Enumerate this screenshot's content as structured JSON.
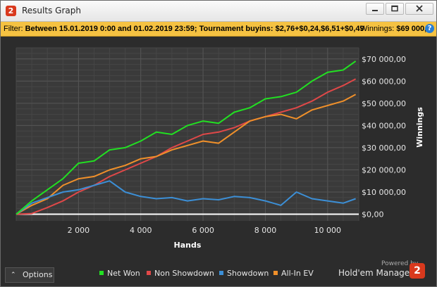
{
  "window": {
    "title": "Results Graph",
    "app_icon_glyph": "2",
    "controls": [
      "minimize-icon",
      "maximize-icon",
      "close-icon"
    ]
  },
  "filter_bar": {
    "prefix": "Filter: ",
    "text": "Between 15.01.2019 0:00 and 01.02.2019 23:59; Tournament buyins: $2,76+$0,24,$6,51+$0,49",
    "winnings_label": "Winnings: ",
    "winnings_value": "$69 000,",
    "help_glyph": "?",
    "bar_color": "#f5c242"
  },
  "footer": {
    "options_label": "Options",
    "powered_by": "Powered by",
    "brand_name": "Hold'em Manager",
    "brand_glyph": "2"
  },
  "colors": {
    "net_won": "#22e022",
    "non_showdown": "#e04848",
    "showdown": "#3c8fd6",
    "all_in_ev": "#f0902a",
    "zero_line": "#ffffff",
    "plot_bg": "#3a3a3a"
  },
  "chart_data": {
    "type": "line",
    "title": "",
    "xlabel": "Hands",
    "ylabel": "Winnings",
    "xlim": [
      0,
      11000
    ],
    "ylim": [
      -3000,
      75000
    ],
    "x_ticks": [
      2000,
      4000,
      6000,
      8000,
      10000
    ],
    "x_tick_labels": [
      "2 000",
      "4 000",
      "6 000",
      "8 000",
      "10 000"
    ],
    "y_ticks": [
      0,
      10000,
      20000,
      30000,
      40000,
      50000,
      60000,
      70000
    ],
    "y_tick_labels": [
      "$0,00",
      "$10 000,00",
      "$20 000,00",
      "$30 000,00",
      "$40 000,00",
      "$50 000,00",
      "$60 000,00",
      "$70 000,00"
    ],
    "grid": true,
    "legend_position": "bottom",
    "series": [
      {
        "name": "Net Won",
        "color": "#22e022",
        "x": [
          0,
          500,
          1000,
          1500,
          2000,
          2500,
          3000,
          3500,
          4000,
          4500,
          5000,
          5500,
          6000,
          6500,
          7000,
          7500,
          8000,
          8500,
          9000,
          9500,
          10000,
          10500,
          10900
        ],
        "values": [
          0,
          6000,
          11000,
          16000,
          23000,
          24000,
          29000,
          30000,
          33000,
          37000,
          36000,
          40000,
          42000,
          41000,
          46000,
          48000,
          52000,
          53000,
          55000,
          60000,
          64000,
          65000,
          69000
        ]
      },
      {
        "name": "Non Showdown",
        "color": "#e04848",
        "x": [
          0,
          500,
          1000,
          1500,
          2000,
          2500,
          3000,
          3500,
          4000,
          4500,
          5000,
          5500,
          6000,
          6500,
          7000,
          7500,
          8000,
          8500,
          9000,
          9500,
          10000,
          10500,
          10900
        ],
        "values": [
          0,
          300,
          3000,
          6000,
          10000,
          13000,
          17000,
          20000,
          23000,
          26000,
          30000,
          33000,
          36000,
          37000,
          39000,
          42000,
          44000,
          46000,
          48000,
          51000,
          55000,
          58000,
          61000
        ]
      },
      {
        "name": "Showdown",
        "color": "#3c8fd6",
        "x": [
          0,
          500,
          1000,
          1500,
          2000,
          2500,
          3000,
          3500,
          4000,
          4500,
          5000,
          5500,
          6000,
          6500,
          7000,
          7500,
          8000,
          8500,
          9000,
          9500,
          10000,
          10500,
          10900
        ],
        "values": [
          0,
          5000,
          7500,
          10000,
          11000,
          13000,
          15000,
          10000,
          8000,
          7000,
          7500,
          6000,
          7000,
          6500,
          8000,
          7500,
          6000,
          4000,
          10000,
          7000,
          6000,
          5000,
          7000
        ]
      },
      {
        "name": "All-In EV",
        "color": "#f0902a",
        "x": [
          0,
          500,
          1000,
          1500,
          2000,
          2500,
          3000,
          3500,
          4000,
          4500,
          5000,
          5500,
          6000,
          6500,
          7000,
          7500,
          8000,
          8500,
          9000,
          9500,
          10000,
          10500,
          10900
        ],
        "values": [
          0,
          4000,
          7000,
          13000,
          16000,
          17000,
          20000,
          22000,
          25000,
          26000,
          29000,
          31000,
          33000,
          32000,
          37000,
          42000,
          44000,
          45000,
          43000,
          47000,
          49000,
          51000,
          54000
        ]
      }
    ]
  }
}
